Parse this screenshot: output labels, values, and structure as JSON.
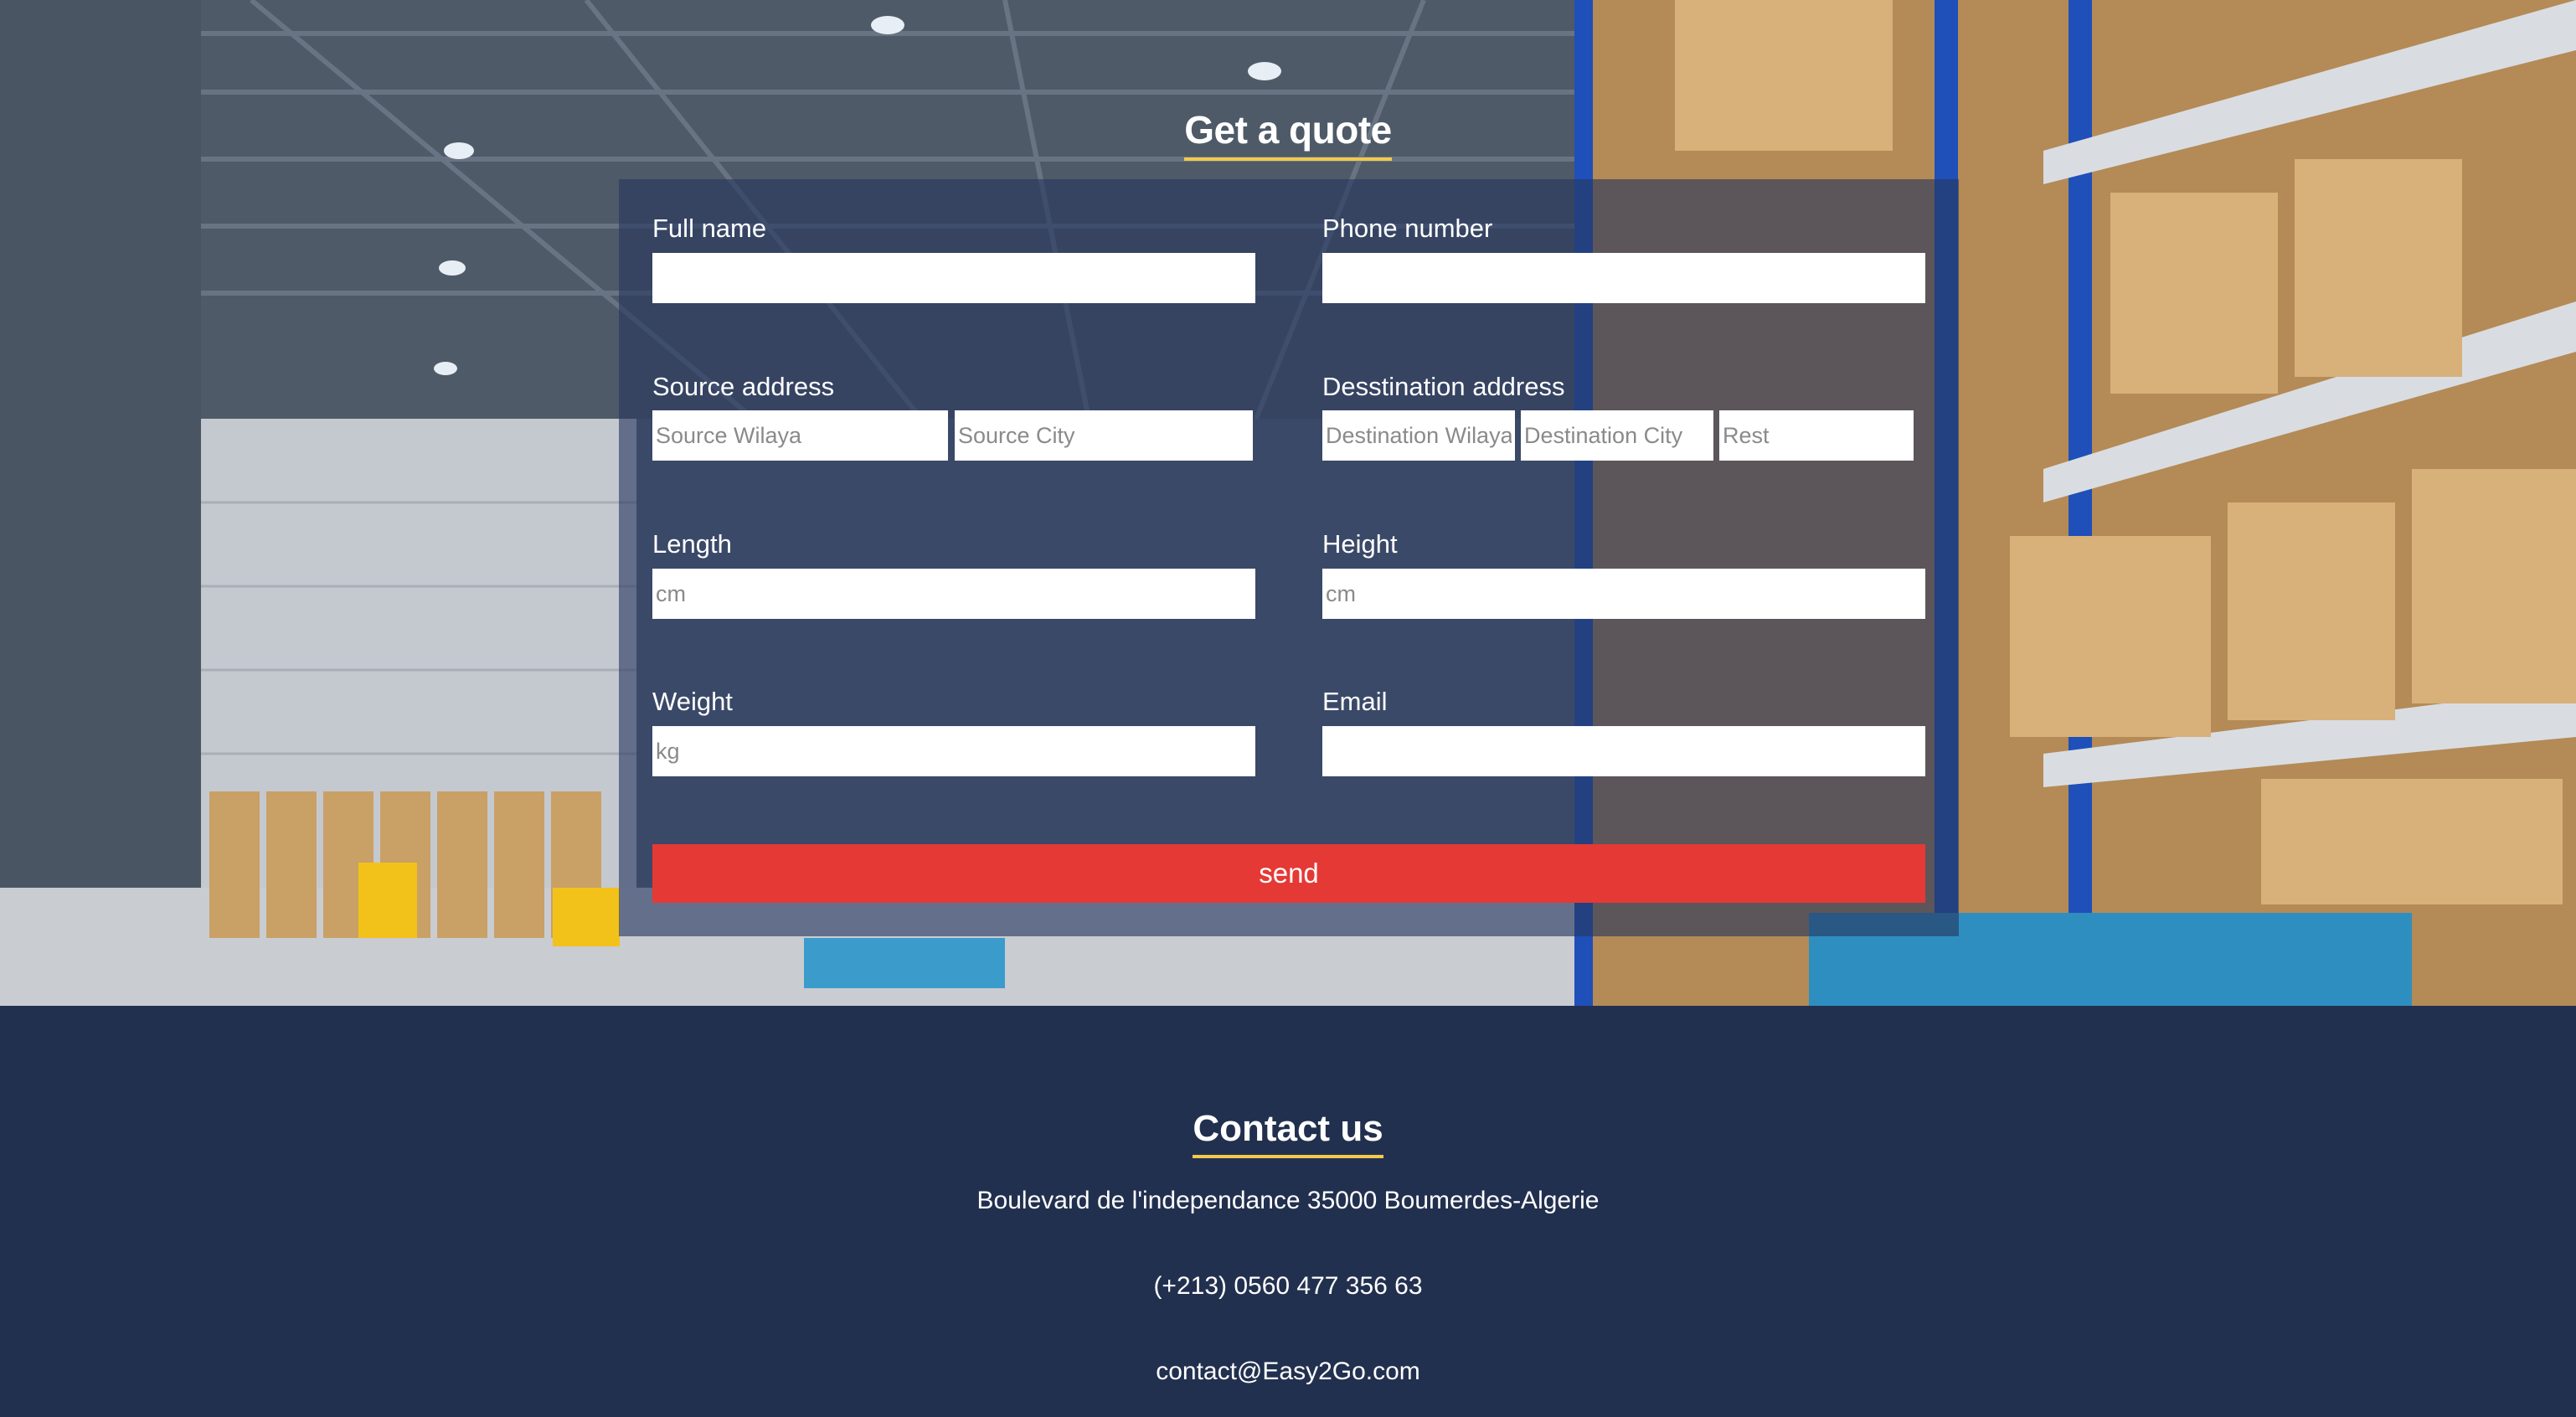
{
  "quote_section": {
    "title": "Get a quote",
    "full_name": {
      "label": "Full name",
      "value": "",
      "placeholder": ""
    },
    "phone_number": {
      "label": "Phone number",
      "value": "",
      "placeholder": ""
    },
    "source_address": {
      "label": "Source address",
      "wilaya_placeholder": "Source Wilaya",
      "city_placeholder": "Source City"
    },
    "destination_address": {
      "label": "Desstination address",
      "wilaya_placeholder": "Destination Wilaya",
      "city_placeholder": "Destination City",
      "rest_placeholder": "Rest"
    },
    "length": {
      "label": "Length",
      "placeholder": "cm"
    },
    "height": {
      "label": "Height",
      "placeholder": "cm"
    },
    "weight": {
      "label": "Weight",
      "placeholder": "kg"
    },
    "email": {
      "label": "Email",
      "value": "",
      "placeholder": ""
    },
    "send_label": "send"
  },
  "contact_section": {
    "title": "Contact us",
    "address": "Boulevard de l'independance 35000 Boumerdes-Algerie",
    "phone": "(+213) 0560 477 356 63",
    "email": "contact@Easy2Go.com"
  },
  "colors": {
    "accent_underline": "#f2c94c",
    "send_button": "#e53935",
    "footer_bg": "#22304f",
    "panel_overlay": "#26375f"
  },
  "background_image": "warehouse-interior"
}
